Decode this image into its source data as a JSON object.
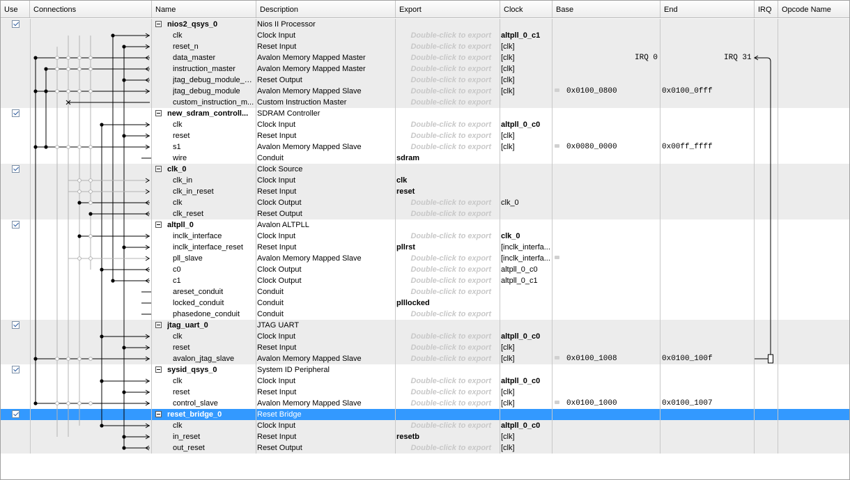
{
  "header": {
    "use": "Use",
    "connections": "Connections",
    "name": "Name",
    "description": "Description",
    "export": "Export",
    "clock": "Clock",
    "base": "Base",
    "end": "End",
    "irq": "IRQ",
    "opcode": "Opcode Name"
  },
  "export_placeholder": "Double-click to export",
  "irq_labels": {
    "start": "IRQ 0",
    "end": "IRQ 31"
  },
  "rows": [
    {
      "type": "comp",
      "name": "nios2_qsys_0",
      "desc": "Nios II Processor",
      "checked": true
    },
    {
      "type": "if",
      "name": "clk",
      "desc": "Clock Input",
      "exp": "",
      "clk": "altpll_0_c1",
      "clkBold": true
    },
    {
      "type": "if",
      "name": "reset_n",
      "desc": "Reset Input",
      "exp": "",
      "clk": "[clk]"
    },
    {
      "type": "if",
      "name": "data_master",
      "desc": "Avalon Memory Mapped Master",
      "exp": "",
      "clk": "[clk]",
      "irq": true
    },
    {
      "type": "if",
      "name": "instruction_master",
      "desc": "Avalon Memory Mapped Master",
      "exp": "",
      "clk": "[clk]"
    },
    {
      "type": "if",
      "name": "jtag_debug_module_re...",
      "desc": "Reset Output",
      "exp": "",
      "clk": "[clk]"
    },
    {
      "type": "if",
      "name": "jtag_debug_module",
      "desc": "Avalon Memory Mapped Slave",
      "exp": "",
      "clk": "[clk]",
      "base": "0x0100_0800",
      "end": "0x0100_0fff"
    },
    {
      "type": "if",
      "name": "custom_instruction_m...",
      "desc": "Custom Instruction Master",
      "exp": ""
    },
    {
      "type": "comp",
      "name": "new_sdram_controll...",
      "desc": "SDRAM Controller",
      "checked": true
    },
    {
      "type": "if",
      "name": "clk",
      "desc": "Clock Input",
      "exp": "",
      "clk": "altpll_0_c0",
      "clkBold": true
    },
    {
      "type": "if",
      "name": "reset",
      "desc": "Reset Input",
      "exp": "",
      "clk": "[clk]"
    },
    {
      "type": "if",
      "name": "s1",
      "desc": "Avalon Memory Mapped Slave",
      "exp": "",
      "clk": "[clk]",
      "base": "0x0080_0000",
      "end": "0x00ff_ffff"
    },
    {
      "type": "if",
      "name": "wire",
      "desc": "Conduit",
      "exp": "sdram"
    },
    {
      "type": "comp",
      "name": "clk_0",
      "desc": "Clock Source",
      "checked": true
    },
    {
      "type": "if",
      "name": "clk_in",
      "desc": "Clock Input",
      "exp": "clk"
    },
    {
      "type": "if",
      "name": "clk_in_reset",
      "desc": "Reset Input",
      "exp": "reset"
    },
    {
      "type": "if",
      "name": "clk",
      "desc": "Clock Output",
      "exp": "",
      "clk": "clk_0"
    },
    {
      "type": "if",
      "name": "clk_reset",
      "desc": "Reset Output",
      "exp": ""
    },
    {
      "type": "comp",
      "name": "altpll_0",
      "desc": "Avalon ALTPLL",
      "checked": true
    },
    {
      "type": "if",
      "name": "inclk_interface",
      "desc": "Clock Input",
      "exp": "",
      "clk": "clk_0",
      "clkBold": true
    },
    {
      "type": "if",
      "name": "inclk_interface_reset",
      "desc": "Reset Input",
      "exp": "pllrst",
      "clk": "[inclk_interfa..."
    },
    {
      "type": "if",
      "name": "pll_slave",
      "desc": "Avalon Memory Mapped Slave",
      "exp": "",
      "clk": "[inclk_interfa...",
      "lockOnly": true
    },
    {
      "type": "if",
      "name": "c0",
      "desc": "Clock Output",
      "exp": "",
      "clk": "altpll_0_c0"
    },
    {
      "type": "if",
      "name": "c1",
      "desc": "Clock Output",
      "exp": "",
      "clk": "altpll_0_c1"
    },
    {
      "type": "if",
      "name": "areset_conduit",
      "desc": "Conduit",
      "exp": ""
    },
    {
      "type": "if",
      "name": "locked_conduit",
      "desc": "Conduit",
      "exp": "plllocked"
    },
    {
      "type": "if",
      "name": "phasedone_conduit",
      "desc": "Conduit",
      "exp": ""
    },
    {
      "type": "comp",
      "name": "jtag_uart_0",
      "desc": "JTAG UART",
      "checked": true
    },
    {
      "type": "if",
      "name": "clk",
      "desc": "Clock Input",
      "exp": "",
      "clk": "altpll_0_c0",
      "clkBold": true
    },
    {
      "type": "if",
      "name": "reset",
      "desc": "Reset Input",
      "exp": "",
      "clk": "[clk]"
    },
    {
      "type": "if",
      "name": "avalon_jtag_slave",
      "desc": "Avalon Memory Mapped Slave",
      "exp": "",
      "clk": "[clk]",
      "base": "0x0100_1008",
      "end": "0x0100_100f"
    },
    {
      "type": "comp",
      "name": "sysid_qsys_0",
      "desc": "System ID Peripheral",
      "checked": true
    },
    {
      "type": "if",
      "name": "clk",
      "desc": "Clock Input",
      "exp": "",
      "clk": "altpll_0_c0",
      "clkBold": true
    },
    {
      "type": "if",
      "name": "reset",
      "desc": "Reset Input",
      "exp": "",
      "clk": "[clk]"
    },
    {
      "type": "if",
      "name": "control_slave",
      "desc": "Avalon Memory Mapped Slave",
      "exp": "",
      "clk": "[clk]",
      "base": "0x0100_1000",
      "end": "0x0100_1007"
    },
    {
      "type": "comp",
      "name": "reset_bridge_0",
      "desc": "Reset Bridge",
      "checked": true,
      "selected": true
    },
    {
      "type": "if",
      "name": "clk",
      "desc": "Clock Input",
      "exp": "",
      "clk": "altpll_0_c0",
      "clkBold": true
    },
    {
      "type": "if",
      "name": "in_reset",
      "desc": "Reset Input",
      "exp": "resetb",
      "clk": "[clk]"
    },
    {
      "type": "if",
      "name": "out_reset",
      "desc": "Reset Output",
      "exp": "",
      "clk": "[clk]"
    }
  ],
  "colors": {
    "selection": "#3399ff",
    "row_shade": "#ececec",
    "wire": "#000000",
    "wire_inactive": "#b4b4b4"
  }
}
